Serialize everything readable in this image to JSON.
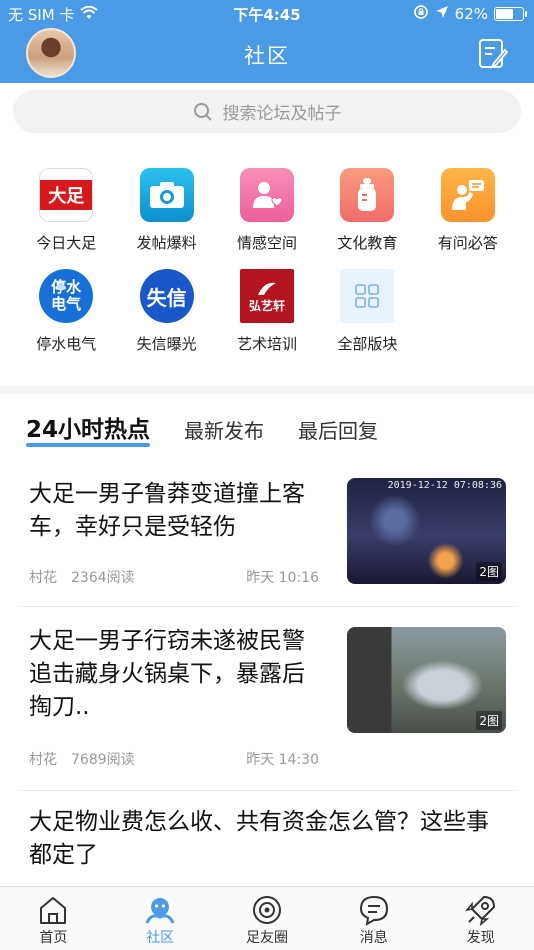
{
  "status_bar": {
    "carrier": "无 SIM 卡",
    "time": "下午4:45",
    "battery_text": "62%",
    "battery_level": 0.62
  },
  "header": {
    "title": "社区"
  },
  "search": {
    "placeholder": "搜索论坛及帖子"
  },
  "categories": [
    {
      "label": "今日大足",
      "icon": "dazu-logo-icon",
      "glyph": "大足"
    },
    {
      "label": "发帖爆料",
      "icon": "camera-icon"
    },
    {
      "label": "情感空间",
      "icon": "person-heart-icon"
    },
    {
      "label": "文化教育",
      "icon": "baby-bottle-icon"
    },
    {
      "label": "有问必答",
      "icon": "question-person-icon"
    },
    {
      "label": "停水电气",
      "icon": "utility-outage-icon",
      "glyph": "停水 电气"
    },
    {
      "label": "失信曝光",
      "icon": "dishonesty-icon",
      "glyph": "失信"
    },
    {
      "label": "艺术培训",
      "icon": "art-school-logo-icon",
      "glyph": "弘艺轩"
    },
    {
      "label": "全部版块",
      "icon": "grid-icon"
    }
  ],
  "tabs": [
    {
      "label": "24小时热点",
      "active": true
    },
    {
      "label": "最新发布",
      "active": false
    },
    {
      "label": "最后回复",
      "active": false
    }
  ],
  "posts": [
    {
      "title": "大足一男子鲁莽变道撞上客车，幸好只是受轻伤",
      "author": "村花",
      "views": "2364阅读",
      "time": "昨天 10:16",
      "image_count": "2图",
      "image_stamp": "2019-12-12 07:08:36"
    },
    {
      "title": "大足一男子行窃未遂被民警追击藏身火锅桌下，暴露后掏刀..",
      "author": "村花",
      "views": "7689阅读",
      "time": "昨天 14:30",
      "image_count": "2图"
    },
    {
      "title": "大足物业费怎么收、共有资金怎么管？这些事都定了"
    }
  ],
  "bottom_nav": [
    {
      "label": "首页",
      "icon": "home-icon",
      "active": false
    },
    {
      "label": "社区",
      "icon": "community-icon",
      "active": true
    },
    {
      "label": "足友圈",
      "icon": "friends-circle-icon",
      "active": false
    },
    {
      "label": "消息",
      "icon": "message-icon",
      "active": false
    },
    {
      "label": "发现",
      "icon": "rocket-icon",
      "active": false
    }
  ],
  "colors": {
    "primary": "#4a9ae6",
    "background": "#ffffff",
    "muted_text": "#999999"
  }
}
